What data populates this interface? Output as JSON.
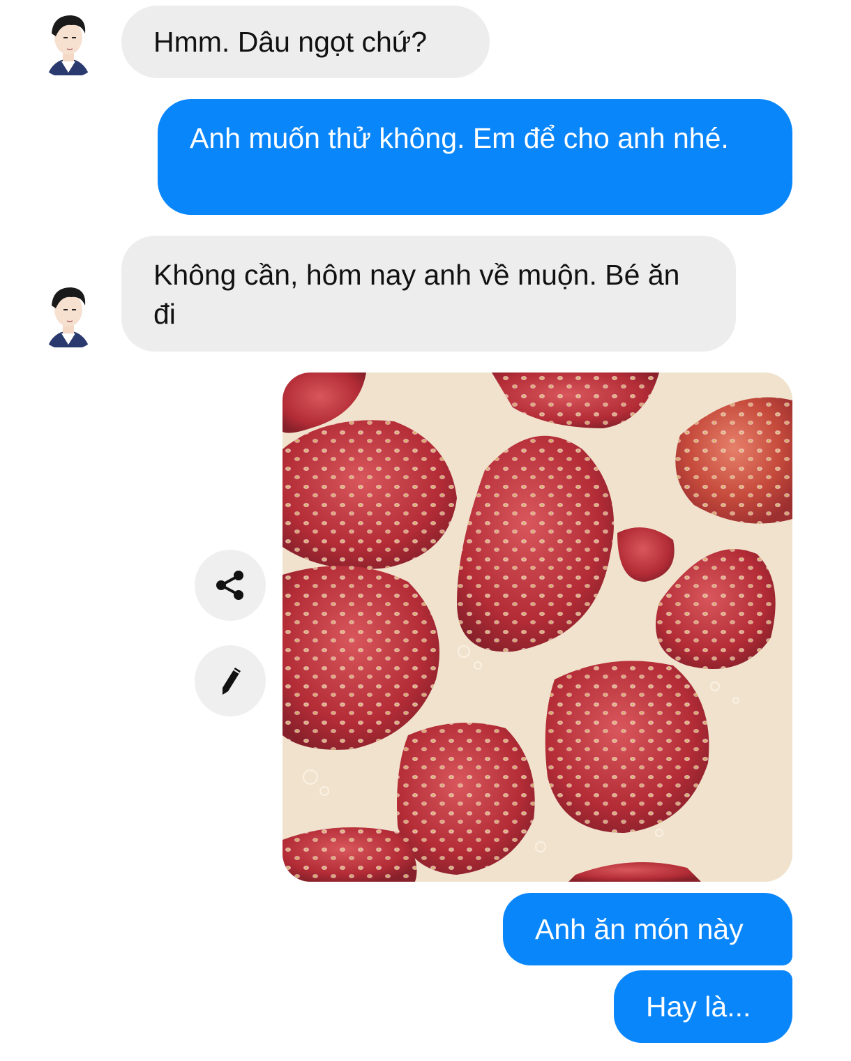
{
  "messages": [
    {
      "sender": "contact",
      "text": "Hmm. Dâu ngọt chứ?"
    },
    {
      "sender": "me",
      "text": "Anh muốn thử không. Em để cho anh nhé."
    },
    {
      "sender": "contact",
      "text": "Không cần, hôm nay anh về muộn. Bé ăn đi"
    },
    {
      "sender": "me",
      "type": "image",
      "content": "strawberries-in-milk-photo"
    },
    {
      "sender": "me",
      "text": "Anh ăn món này"
    },
    {
      "sender": "me",
      "text": "Hay là..."
    }
  ],
  "actions": {
    "share_icon": "share-icon",
    "edit_icon": "pencil-icon"
  },
  "colors": {
    "outgoing_bubble": "#0a86fb",
    "incoming_bubble": "#ededed",
    "action_button": "#efefef"
  }
}
